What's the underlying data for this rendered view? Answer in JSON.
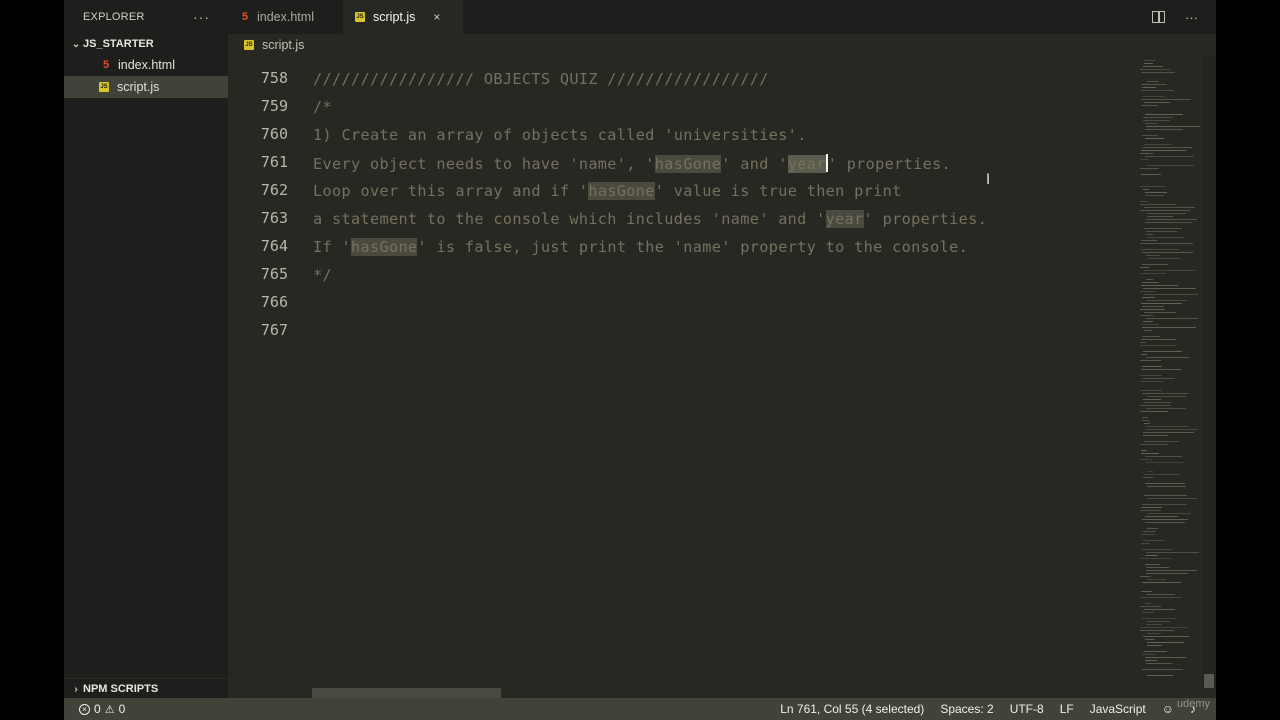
{
  "explorer": {
    "title": "EXPLORER",
    "more": "···",
    "folder": "JS_STARTER",
    "files": [
      {
        "name": "index.html",
        "icon": "html-file-icon"
      },
      {
        "name": "script.js",
        "icon": "js-file-icon"
      }
    ],
    "npm_scripts": "NPM SCRIPTS"
  },
  "tabs": [
    {
      "label": "index.html"
    },
    {
      "label": "script.js",
      "close": "×"
    }
  ],
  "tab_actions": {
    "more": "···"
  },
  "breadcrumb": "script.js",
  "editor": {
    "lines": [
      {
        "num": "758",
        "text": "///////////////// OBJECTS QUIZ /////////////////"
      },
      {
        "num": "759",
        "text": "/*"
      },
      {
        "num": "760",
        "text": "1) Create an array of objects called 'universities'."
      },
      {
        "num": "761",
        "pre": "Every object needs to have 'name', '",
        "w1": "hasGone",
        "mid": "' and '",
        "sel": "year",
        "post": "' properties."
      },
      {
        "num": "762",
        "pre": "Loop over this array and if '",
        "w1": "hasGone",
        "post": "' value is true then print"
      },
      {
        "num": "763",
        "pre": "a statement to the console which includes 'name' and '",
        "w1": "year",
        "post": "' properties."
      },
      {
        "num": "764",
        "pre": "If '",
        "w1": "hasGone",
        "post": "' is false, just print the 'name' property to the console."
      },
      {
        "num": "765",
        "text": "*/"
      },
      {
        "num": "766",
        "text": ""
      },
      {
        "num": "767",
        "text": ""
      }
    ]
  },
  "status": {
    "errors": "0",
    "warnings": "0",
    "position": "Ln 761, Col 55 (4 selected)",
    "spaces": "Spaces: 2",
    "encoding": "UTF-8",
    "eol": "LF",
    "language": "JavaScript",
    "watermark": "udemy"
  }
}
